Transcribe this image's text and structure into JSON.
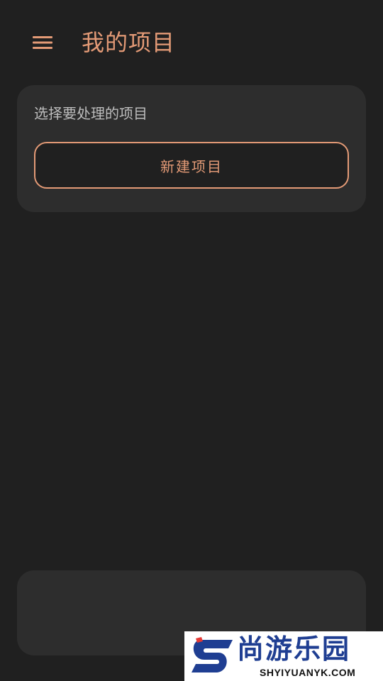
{
  "header": {
    "title": "我的项目",
    "menu_icon": "hamburger-menu-icon",
    "accent_color": "#E39A76"
  },
  "project_card": {
    "prompt": "选择要处理的项目",
    "new_project_label": "新建项目"
  },
  "watermark": {
    "name": "尚游乐园",
    "domain": "SHYIYUANYK.COM",
    "logo_icon": "s-logo-icon",
    "brand_color": "#1F3E92",
    "logo_accent": "#E53935"
  },
  "theme": {
    "background": "#202020",
    "card": "#2D2D2D",
    "secondary_text": "#BDBDBD"
  }
}
